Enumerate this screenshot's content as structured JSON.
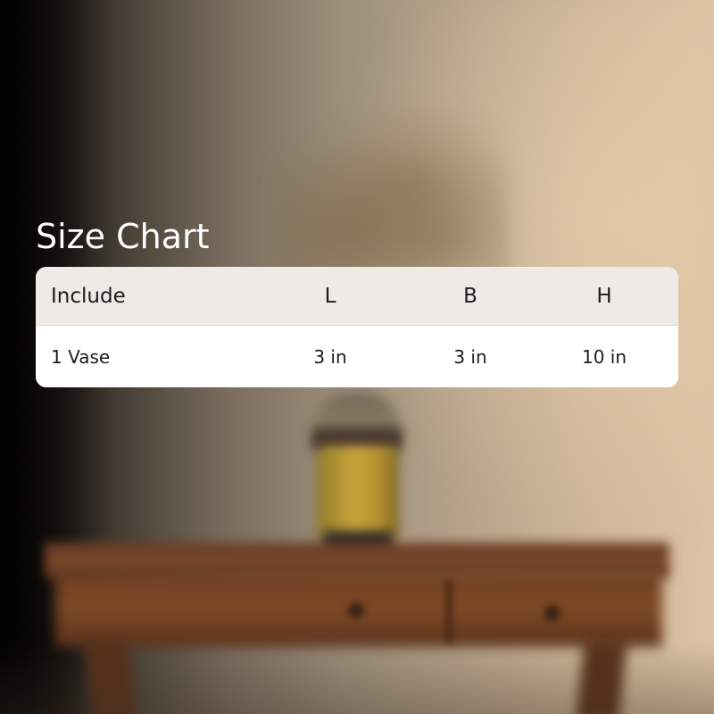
{
  "size_chart": {
    "title": "Size Chart",
    "columns": [
      "Include",
      "L",
      "B",
      "H"
    ],
    "rows": [
      {
        "include": "1 Vase",
        "l": "3 in",
        "b": "3 in",
        "h": "10 in"
      }
    ]
  },
  "colors": {
    "title_text": "#ffffff",
    "header_bg": "#eeebe6",
    "body_bg": "#ffffff",
    "cell_text": "#1c1c1c"
  }
}
